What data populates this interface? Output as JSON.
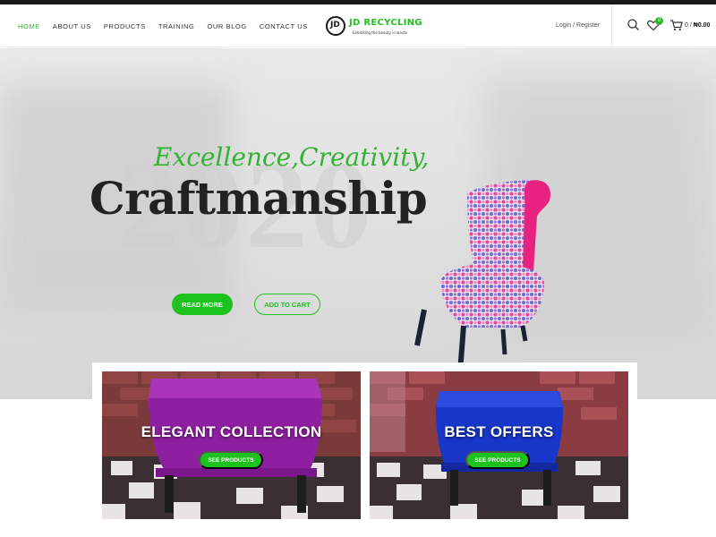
{
  "header": {
    "nav": [
      {
        "label": "HOME",
        "active": true
      },
      {
        "label": "ABOUT US"
      },
      {
        "label": "PRODUCTS"
      },
      {
        "label": "TRAINING"
      },
      {
        "label": "OUR BLOG"
      },
      {
        "label": "CONTACT US"
      }
    ],
    "logo": {
      "mark": "JD",
      "name": "JD RECYCLING",
      "tagline": "Exhibiting the beauty in waste"
    },
    "login_label": "Login / Register",
    "wishlist_count": "0",
    "cart_count": "0",
    "cart_separator": "/",
    "cart_total": "₦0.00",
    "icons": [
      "search-icon",
      "heart-icon",
      "cart-icon"
    ]
  },
  "hero": {
    "background_text": "2020",
    "script_title": "Excellence,Creativity,",
    "headline": "Craftmanship",
    "primary_button": "READ MORE",
    "secondary_button": "ADD TO CART"
  },
  "cards": [
    {
      "title": "ELEGANT COLLECTION",
      "button": "SEE PRODUCTS"
    },
    {
      "title": "BEST OFFERS",
      "button": "SEE PRODUCTS"
    }
  ],
  "colors": {
    "accent": "#1ec21e",
    "nav_active": "#34b233",
    "dark": "#1a1a1a"
  }
}
